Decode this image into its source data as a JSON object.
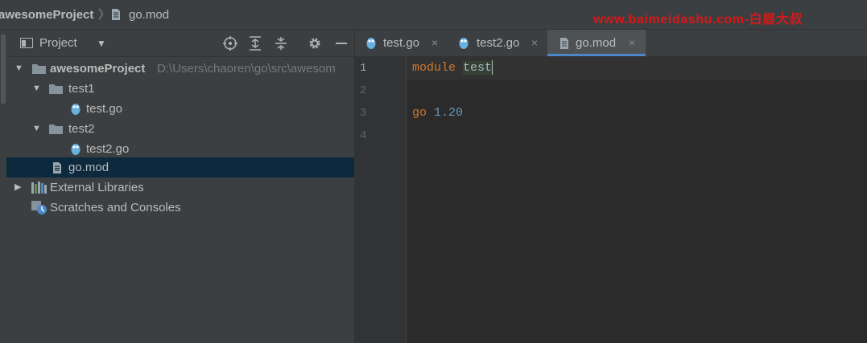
{
  "breadcrumb": {
    "project": "awesomeProject",
    "separator": "〉",
    "file": "go.mod"
  },
  "watermark": "www.baimeidashu.com-白眉大叔",
  "project_panel": {
    "title": "Project",
    "tree": {
      "root": {
        "name": "awesomeProject",
        "path": "D:\\Users\\chaoren\\go\\src\\awesom"
      },
      "folder1": "test1",
      "file1": "test.go",
      "folder2": "test2",
      "file2": "test2.go",
      "gomod": "go.mod",
      "external": "External Libraries",
      "scratches": "Scratches and Consoles"
    }
  },
  "tabs": [
    {
      "label": "test.go",
      "close": "×"
    },
    {
      "label": "test2.go",
      "close": "×"
    },
    {
      "label": "go.mod",
      "close": "×"
    }
  ],
  "editor": {
    "line_numbers": [
      "1",
      "2",
      "3",
      "4"
    ],
    "line1_keyword": "module",
    "line1_name": "test",
    "line3_keyword": "go",
    "line3_version": "1.20"
  },
  "colors": {
    "accent": "#4a88c7",
    "selection": "#0d293e",
    "watermark": "#d81818",
    "keyword": "#cc7832",
    "number": "#6897bb"
  }
}
